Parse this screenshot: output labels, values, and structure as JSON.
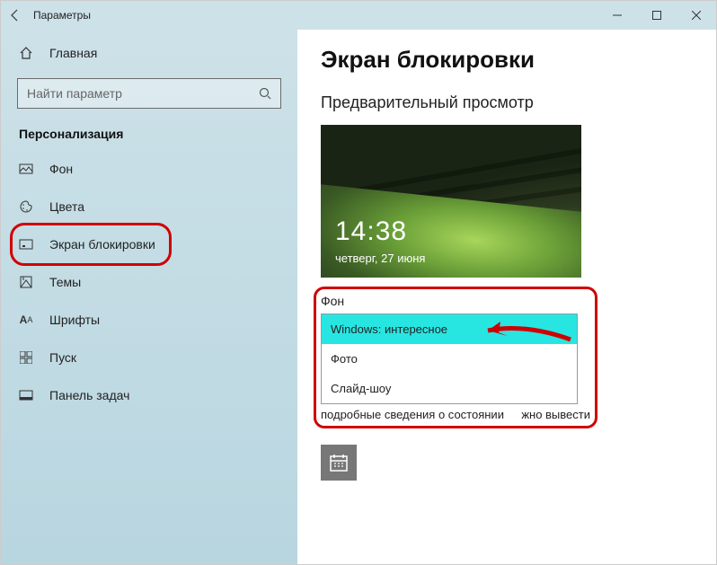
{
  "titlebar": {
    "title": "Параметры"
  },
  "sidebar": {
    "home": "Главная",
    "search_placeholder": "Найти параметр",
    "section": "Персонализация",
    "items": [
      {
        "label": "Фон"
      },
      {
        "label": "Цвета"
      },
      {
        "label": "Экран блокировки"
      },
      {
        "label": "Темы"
      },
      {
        "label": "Шрифты"
      },
      {
        "label": "Пуск"
      },
      {
        "label": "Панель задач"
      }
    ]
  },
  "main": {
    "heading": "Экран блокировки",
    "preview_label": "Предварительный просмотр",
    "preview_time": "14:38",
    "preview_date": "четверг, 27 июня",
    "bg_label": "Фон",
    "dropdown": [
      "Windows: интересное",
      "Фото",
      "Слайд-шоу"
    ],
    "partial_left": "подробные сведения о состоянии",
    "partial_right": "жно вывести"
  }
}
